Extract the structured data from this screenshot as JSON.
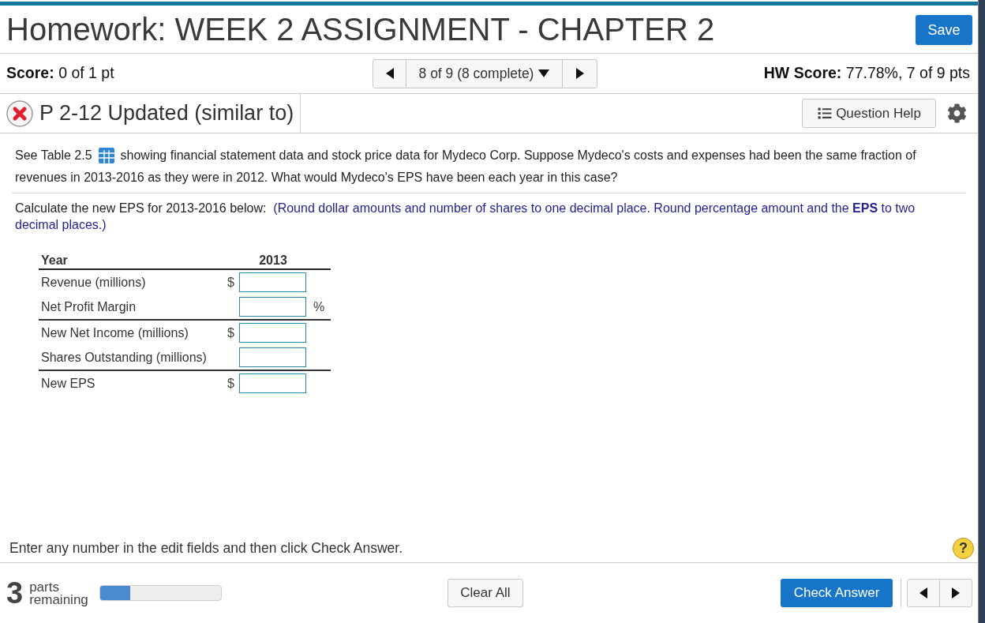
{
  "header": {
    "title": "Homework: WEEK 2 ASSIGNMENT - CHAPTER 2",
    "save_button": "Save"
  },
  "score_bar": {
    "score": {
      "label": "Score:",
      "value": "0 of 1 pt"
    },
    "navigator": {
      "position": "8 of 9 (8 complete)"
    },
    "hw_score": {
      "label": "HW Score:",
      "value": "77.78%, 7 of 9 pts"
    }
  },
  "question": {
    "correct": false,
    "title": "P 2-12 Updated (similar to)",
    "help_button": "Question Help"
  },
  "prompt": {
    "before_icon": "See Table 2.5",
    "after_icon": "showing financial statement data and stock price data for Mydeco Corp. Suppose Mydeco's costs and expenses had been the same fraction of revenues in 2013-2016 as they were in 2012. What would Mydeco's EPS have been each year in this case?"
  },
  "instruction": {
    "text": "Calculate the new EPS for 2013-2016 below:",
    "note": "(Round dollar amounts and number of shares to one decimal place. Round percentage amount and the **EPS** to two decimal places.)"
  },
  "table": {
    "columns": [
      "Year",
      "2013"
    ],
    "row_groups": [
      {
        "rows": [
          {
            "label": "Revenue (millions)",
            "prefix": "$"
          },
          {
            "label": "Net Profit Margin",
            "suffix": "%"
          }
        ]
      },
      {
        "rows": [
          {
            "label": "New Net Income (millions)",
            "prefix": "$"
          },
          {
            "label": "Shares Outstanding (millions)"
          }
        ]
      },
      {
        "rows": [
          {
            "label": "New EPS",
            "prefix": "$"
          }
        ]
      }
    ]
  },
  "hint": {
    "text": "Enter any number in the edit fields and then click Check Answer.",
    "help_glyph": "?"
  },
  "footer": {
    "parts_count": "3",
    "parts_label": "parts remaining",
    "progress": {
      "level": 0.25
    },
    "clear_button": "Clear All",
    "check_button": "Check Answer"
  }
}
